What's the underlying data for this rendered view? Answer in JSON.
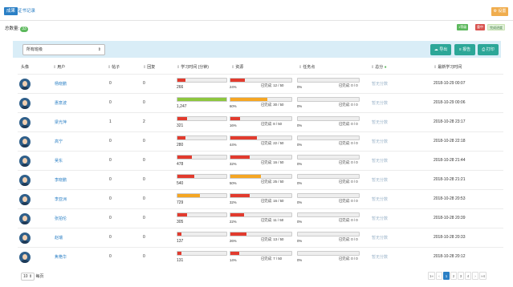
{
  "tabs": [
    {
      "label": "成果"
    },
    {
      "label": "证书记录"
    }
  ],
  "settings_button": "⚙ 设置",
  "total": {
    "label": "总数量:",
    "value": "33"
  },
  "legend": [
    "1等级",
    "重中",
    "完成进度"
  ],
  "filter": {
    "selected": "所有班级"
  },
  "actions": {
    "export": "导出",
    "report": "报告",
    "print": "打印"
  },
  "headers": {
    "avatar": "头像",
    "user": "用户",
    "posts": "帖子",
    "replies": "回复",
    "study_time": "学习时间 (分钟)",
    "resources": "资源",
    "tasks": "任务点",
    "total_score": "总分",
    "last_study": "最新学习时间"
  },
  "colors": {
    "red": "#e23b2e",
    "orange": "#f5a623",
    "green": "#8dc63f",
    "teal": "#2ca798",
    "blue": "#2a7fc5"
  },
  "rows": [
    {
      "name": "杨晓鹏",
      "posts": "0",
      "replies": "0",
      "study": "266",
      "study_level": 0.17,
      "study_color": "#e23b2e",
      "res_pct": "24%",
      "res_done": "已完成: 12 / 50",
      "res_level": 0.24,
      "res_color": "#e23b2e",
      "task_pct": "0%",
      "task_done": "已完成: 0 / 0",
      "score": "暂无分数",
      "last": "2018-10-29 00:07"
    },
    {
      "name": "惠意波",
      "posts": "0",
      "replies": "0",
      "study": "1,247",
      "study_level": 1.0,
      "study_color": "#8dc63f",
      "res_pct": "60%",
      "res_done": "已完成: 30 / 50",
      "res_level": 0.6,
      "res_color": "#f5a623",
      "task_pct": "0%",
      "task_done": "已完成: 0 / 0",
      "score": "暂无分数",
      "last": "2018-10-29 00:06"
    },
    {
      "name": "梁光萍",
      "posts": "1",
      "replies": "2",
      "study": "321",
      "study_level": 0.2,
      "study_color": "#e23b2e",
      "res_pct": "16%",
      "res_done": "已完成: 8 / 50",
      "res_level": 0.16,
      "res_color": "#e23b2e",
      "task_pct": "0%",
      "task_done": "已完成: 0 / 0",
      "score": "暂无分数",
      "last": "2018-10-28 23:17"
    },
    {
      "name": "高宁",
      "posts": "0",
      "replies": "0",
      "study": "280",
      "study_level": 0.17,
      "study_color": "#e23b2e",
      "res_pct": "44%",
      "res_done": "已完成: 22 / 50",
      "res_level": 0.44,
      "res_color": "#e23b2e",
      "task_pct": "0%",
      "task_done": "已完成: 0 / 0",
      "score": "暂无分数",
      "last": "2018-10-28 22:18"
    },
    {
      "name": "吴东",
      "posts": "0",
      "replies": "0",
      "study": "478",
      "study_level": 0.3,
      "study_color": "#e23b2e",
      "res_pct": "32%",
      "res_done": "已完成: 16 / 50",
      "res_level": 0.32,
      "res_color": "#e23b2e",
      "task_pct": "0%",
      "task_done": "已完成: 0 / 0",
      "score": "暂无分数",
      "last": "2018-10-28 21:44"
    },
    {
      "name": "李晓鹏",
      "posts": "0",
      "replies": "0",
      "study": "540",
      "study_level": 0.34,
      "study_color": "#e23b2e",
      "res_pct": "50%",
      "res_done": "已完成: 25 / 50",
      "res_level": 0.5,
      "res_color": "#f5a623",
      "task_pct": "0%",
      "task_done": "已完成: 0 / 0",
      "score": "暂无分数",
      "last": "2018-10-28 21:21"
    },
    {
      "name": "李亚洲",
      "posts": "0",
      "replies": "0",
      "study": "729",
      "study_level": 0.46,
      "study_color": "#f5a623",
      "res_pct": "32%",
      "res_done": "已完成: 16 / 50",
      "res_level": 0.32,
      "res_color": "#e23b2e",
      "task_pct": "0%",
      "task_done": "已完成: 0 / 0",
      "score": "暂无分数",
      "last": "2018-10-28 20:53"
    },
    {
      "name": "张拍伦",
      "posts": "0",
      "replies": "0",
      "study": "305",
      "study_level": 0.19,
      "study_color": "#e23b2e",
      "res_pct": "22%",
      "res_done": "已完成: 11 / 50",
      "res_level": 0.22,
      "res_color": "#e23b2e",
      "task_pct": "0%",
      "task_done": "已完成: 0 / 0",
      "score": "暂无分数",
      "last": "2018-10-28 20:39"
    },
    {
      "name": "赵瑞",
      "posts": "0",
      "replies": "0",
      "study": "137",
      "study_level": 0.09,
      "study_color": "#e23b2e",
      "res_pct": "26%",
      "res_done": "已完成: 13 / 50",
      "res_level": 0.26,
      "res_color": "#e23b2e",
      "task_pct": "0%",
      "task_done": "已完成: 0 / 0",
      "score": "暂无分数",
      "last": "2018-10-28 20:33"
    },
    {
      "name": "焦艳华",
      "posts": "0",
      "replies": "0",
      "study": "131",
      "study_level": 0.08,
      "study_color": "#e23b2e",
      "res_pct": "14%",
      "res_done": "已完成: 7 / 50",
      "res_level": 0.14,
      "res_color": "#e23b2e",
      "task_pct": "0%",
      "task_done": "已完成: 0 / 0",
      "score": "暂无分数",
      "last": "2018-10-28 20:12"
    }
  ],
  "pagination": {
    "page_size": "10 ⇕",
    "page_size_suffix": "每页",
    "pages": [
      "1«",
      "‹",
      "1",
      "2",
      "3",
      "4",
      "›",
      "»4"
    ]
  }
}
